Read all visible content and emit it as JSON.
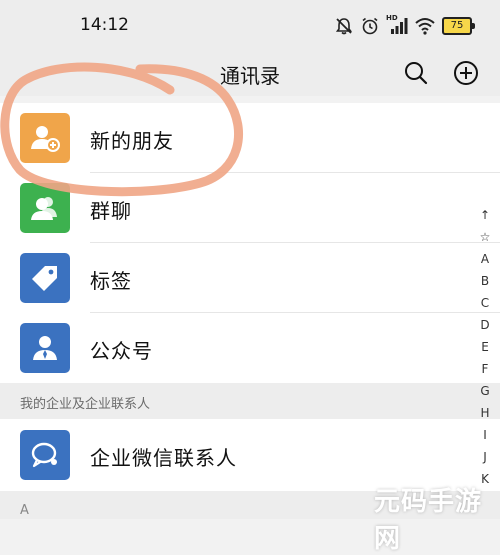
{
  "status_bar": {
    "time": "14:12",
    "network_label": "HD",
    "battery": "75",
    "icons": [
      "bell-off-icon",
      "alarm-icon",
      "signal-icon",
      "wifi-icon",
      "battery-icon"
    ]
  },
  "header": {
    "title": "通讯录",
    "search_icon": "search-icon",
    "add_icon": "plus-circle-icon"
  },
  "contacts_menu": {
    "items": [
      {
        "label": "新的朋友",
        "icon": "add-friend-icon",
        "color": "#f0a54a"
      },
      {
        "label": "群聊",
        "icon": "group-chat-icon",
        "color": "#3db14f"
      },
      {
        "label": "标签",
        "icon": "tag-icon",
        "color": "#3b72c0"
      },
      {
        "label": "公众号",
        "icon": "official-account-icon",
        "color": "#3b72c0"
      }
    ]
  },
  "enterprise_section": {
    "header": "我的企业及企业联系人",
    "item": {
      "label": "企业微信联系人",
      "icon": "enterprise-chat-icon",
      "color": "#3b72c0"
    }
  },
  "letter_section": {
    "header": "A"
  },
  "index_bar": [
    "↑",
    "☆",
    "A",
    "B",
    "C",
    "D",
    "E",
    "F",
    "G",
    "H",
    "I",
    "J",
    "K"
  ],
  "annotation": {
    "color": "#f0a585"
  },
  "watermark": {
    "text": "元码手游网"
  }
}
